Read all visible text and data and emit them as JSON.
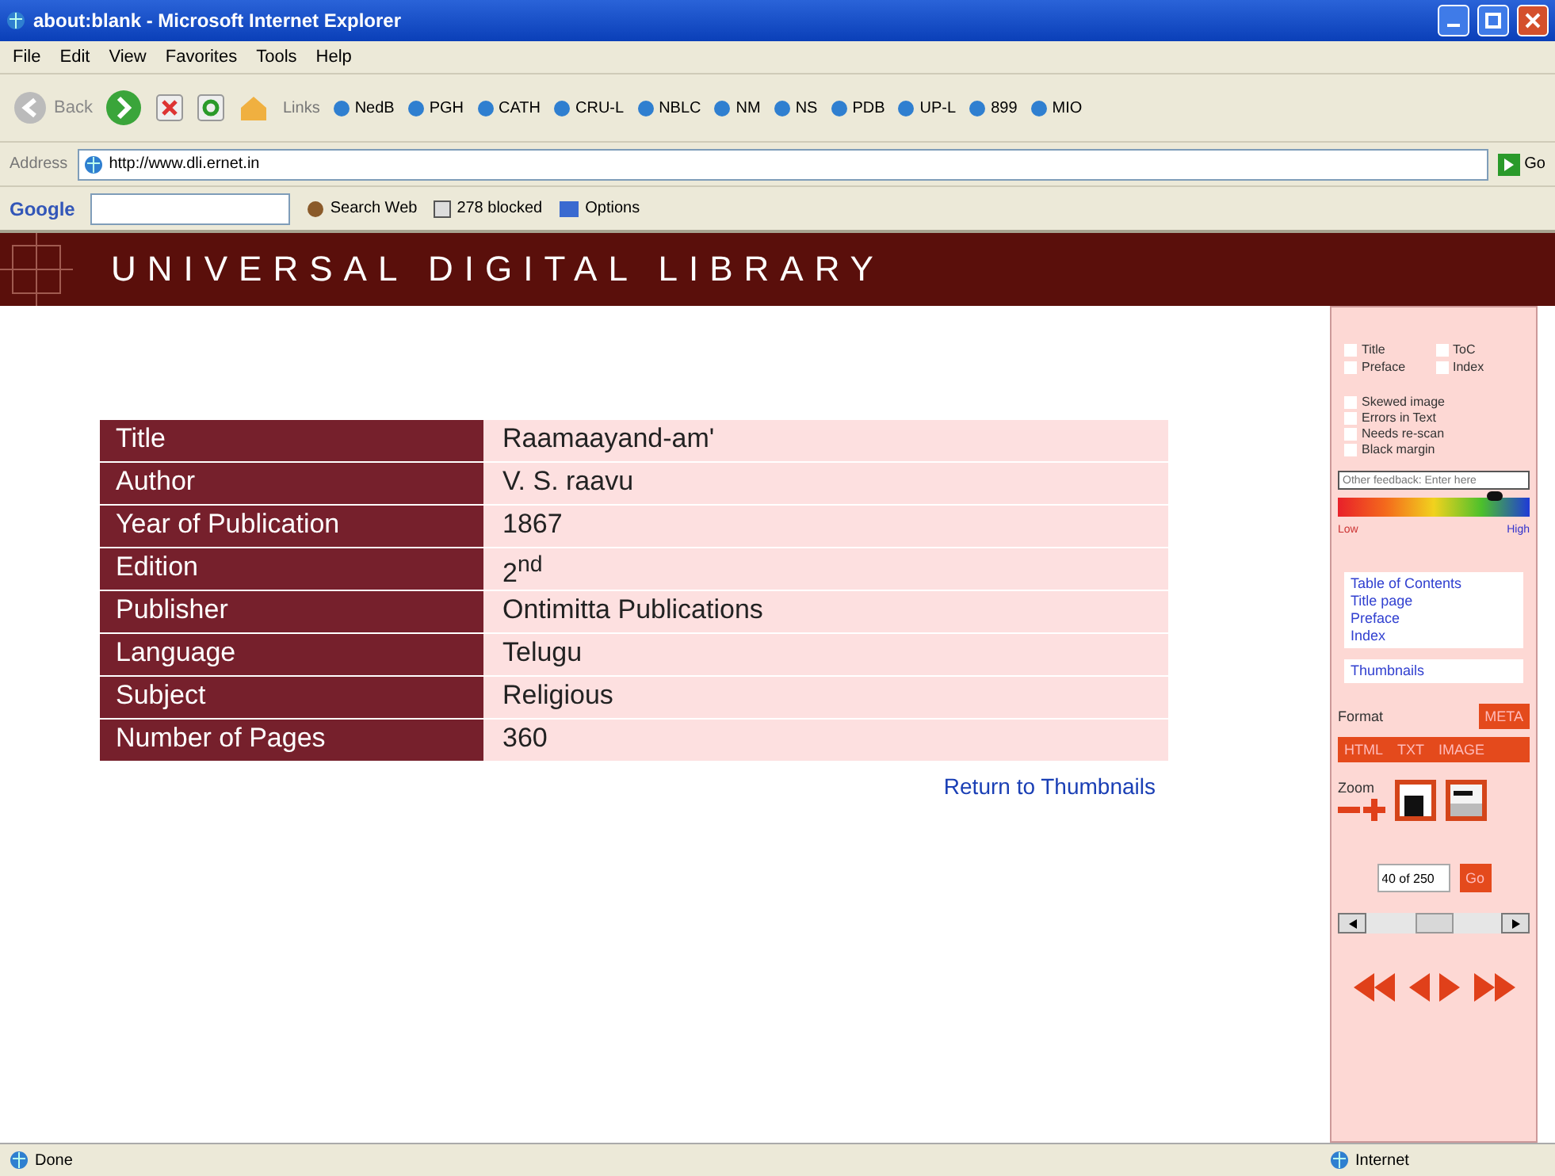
{
  "window": {
    "title": "about:blank - Microsoft Internet Explorer"
  },
  "menu": [
    "File",
    "Edit",
    "View",
    "Favorites",
    "Tools",
    "Help"
  ],
  "nav": {
    "back": "Back",
    "links_label": "Links",
    "links": [
      "NedB",
      "PGH",
      "CATH",
      "CRU-L",
      "NBLC",
      "NM",
      "NS",
      "PDB",
      "UP-L",
      "899",
      "MIO"
    ]
  },
  "address": {
    "label": "Address",
    "url": "http://www.dli.ernet.in",
    "go": "Go"
  },
  "google": {
    "logo": "Google",
    "search": "Search Web",
    "blocked": "278 blocked",
    "options": "Options"
  },
  "banner": {
    "title": "UNIVERSAL DIGITAL LIBRARY"
  },
  "book": {
    "rows": [
      {
        "label": "Title",
        "value": "Raamaayand-am'"
      },
      {
        "label": "Author",
        "value": "V. S. raavu"
      },
      {
        "label": "Year of Publication",
        "value": "1867"
      },
      {
        "label": "Edition",
        "value": "2$^{nd}$"
      },
      {
        "label": "Publisher",
        "value": "Ontimitta Publications"
      },
      {
        "label": "Language",
        "value": "Telugu"
      },
      {
        "label": "Subject",
        "value": "Religious"
      },
      {
        "label": "Number of Pages",
        "value": "360"
      }
    ],
    "return_link": "Return to Thumbnails"
  },
  "sidebar": {
    "page_types": [
      {
        "label": "Title",
        "checked": false
      },
      {
        "label": "ToC",
        "checked": false
      },
      {
        "label": "Preface",
        "checked": false
      },
      {
        "label": "Index",
        "checked": false
      }
    ],
    "problems": [
      {
        "label": "Skewed image",
        "checked": false
      },
      {
        "label": "Errors in Text",
        "checked": false
      },
      {
        "label": "Needs re-scan",
        "checked": false
      },
      {
        "label": "Black margin",
        "checked": false
      }
    ],
    "feedback": {
      "placeholder": "Other feedback: Enter here"
    },
    "quality": {
      "low": "Low",
      "high": "High",
      "level": 0.82
    },
    "contents": [
      "Table of Contents",
      "Title page",
      "Preface",
      "Index"
    ],
    "thumbnails": "Thumbnails",
    "format": {
      "label": "Format",
      "options": [
        "META",
        "HTML",
        "TXT",
        "IMAGE"
      ]
    },
    "zoom": "Zoom",
    "page": {
      "value": "40 of 250",
      "go": "Go"
    }
  },
  "status_bar": {
    "left": "Done",
    "zone": "Internet"
  }
}
